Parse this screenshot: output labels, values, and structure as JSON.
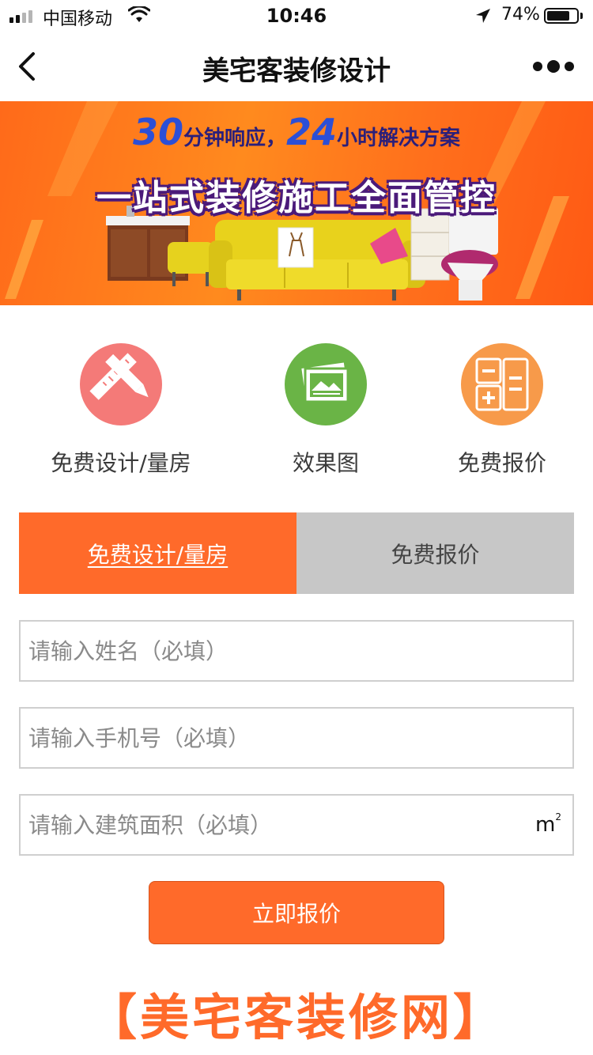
{
  "status_bar": {
    "carrier": "中国移动",
    "time": "10:46",
    "battery_percent": "74%",
    "battery_level": 0.74,
    "signal_bars": 2
  },
  "nav": {
    "title": "美宅客装修设计",
    "back_icon": "chevron-left-icon",
    "more_icon": "more-dots-icon"
  },
  "banner": {
    "line1_num1": "30",
    "line1_text1": "分钟响应，",
    "line1_num2": "24",
    "line1_text2": "小时解决方案",
    "line2": "一站式装修施工全面管控"
  },
  "entries": [
    {
      "label": "免费设计/量房",
      "icon": "pencil-ruler-icon",
      "color": "#f47a78"
    },
    {
      "label": "效果图",
      "icon": "picture-icon",
      "color": "#6ab446"
    },
    {
      "label": "免费报价",
      "icon": "calculator-icon",
      "color": "#f79a4a"
    }
  ],
  "tabs": [
    {
      "label": "免费设计/量房",
      "active": true
    },
    {
      "label": "免费报价",
      "active": false
    }
  ],
  "form": {
    "name_placeholder": "请输入姓名（必填）",
    "phone_placeholder": "请输入手机号（必填）",
    "area_placeholder": "请输入建筑面积（必填）",
    "area_unit": "m",
    "area_unit_sup": "2",
    "submit_label": "立即报价"
  },
  "footer": {
    "brand": "【美宅客装修网】"
  },
  "colors": {
    "accent": "#ff6a2a",
    "tab_inactive": "#c7c7c7"
  }
}
